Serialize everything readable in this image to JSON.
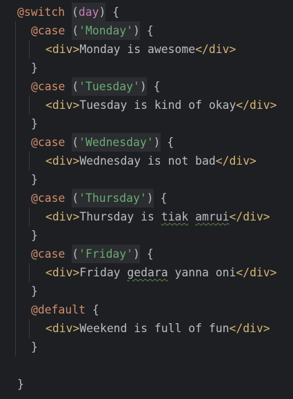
{
  "colors": {
    "background": "#1e1f22",
    "keyword": "#cf8e6d",
    "string": "#6aab73",
    "variable": "#c77dbb",
    "tag": "#d5b778",
    "text": "#bcbec4"
  },
  "lines": [
    {
      "indent": 1,
      "tokens": [
        {
          "t": "kw",
          "v": "@switch"
        },
        {
          "t": "pun",
          "v": " "
        },
        {
          "t": "pun",
          "v": "(",
          "hl": true
        },
        {
          "t": "var",
          "v": "day",
          "hl": true
        },
        {
          "t": "pun",
          "v": ")",
          "hl": true
        },
        {
          "t": "pun",
          "v": " {"
        }
      ]
    },
    {
      "indent": 2,
      "tokens": [
        {
          "t": "kw",
          "v": "@case"
        },
        {
          "t": "pun",
          "v": " "
        },
        {
          "t": "pun",
          "v": "(",
          "hl": true
        },
        {
          "t": "str",
          "v": "'Monday'",
          "hl": true
        },
        {
          "t": "pun",
          "v": ")",
          "hl": true
        },
        {
          "t": "pun",
          "v": " {"
        }
      ]
    },
    {
      "indent": 3,
      "tokens": [
        {
          "t": "tag",
          "v": "<div>"
        },
        {
          "t": "txt",
          "v": "Monday is awesome"
        },
        {
          "t": "tag",
          "v": "</div>"
        }
      ]
    },
    {
      "indent": 2,
      "tokens": [
        {
          "t": "pun",
          "v": "}"
        }
      ]
    },
    {
      "indent": 2,
      "tokens": [
        {
          "t": "kw",
          "v": "@case"
        },
        {
          "t": "pun",
          "v": " "
        },
        {
          "t": "pun",
          "v": "(",
          "hl": true
        },
        {
          "t": "str",
          "v": "'Tuesday'",
          "hl": true
        },
        {
          "t": "pun",
          "v": ")",
          "hl": true
        },
        {
          "t": "pun",
          "v": " {"
        }
      ]
    },
    {
      "indent": 3,
      "tokens": [
        {
          "t": "tag",
          "v": "<div>"
        },
        {
          "t": "txt",
          "v": "Tuesday is kind of okay"
        },
        {
          "t": "tag",
          "v": "</div>"
        }
      ]
    },
    {
      "indent": 2,
      "tokens": [
        {
          "t": "pun",
          "v": "}"
        }
      ]
    },
    {
      "indent": 2,
      "tokens": [
        {
          "t": "kw",
          "v": "@case"
        },
        {
          "t": "pun",
          "v": " "
        },
        {
          "t": "pun",
          "v": "(",
          "hl": true
        },
        {
          "t": "str",
          "v": "'Wednesday'",
          "hl": true
        },
        {
          "t": "pun",
          "v": ")",
          "hl": true
        },
        {
          "t": "pun",
          "v": " {"
        }
      ]
    },
    {
      "indent": 3,
      "tokens": [
        {
          "t": "tag",
          "v": "<div>"
        },
        {
          "t": "txt",
          "v": "Wednesday is not bad"
        },
        {
          "t": "tag",
          "v": "</div>"
        }
      ]
    },
    {
      "indent": 2,
      "tokens": [
        {
          "t": "pun",
          "v": "}"
        }
      ]
    },
    {
      "indent": 2,
      "tokens": [
        {
          "t": "kw",
          "v": "@case"
        },
        {
          "t": "pun",
          "v": " "
        },
        {
          "t": "pun",
          "v": "(",
          "hl": true
        },
        {
          "t": "str",
          "v": "'Thursday'",
          "hl": true
        },
        {
          "t": "pun",
          "v": ")",
          "hl": true
        },
        {
          "t": "pun",
          "v": " {"
        }
      ]
    },
    {
      "indent": 3,
      "tokens": [
        {
          "t": "tag",
          "v": "<div>"
        },
        {
          "t": "txt",
          "v": "Thursday is "
        },
        {
          "t": "txt",
          "v": "tiak",
          "typo": true
        },
        {
          "t": "txt",
          "v": " "
        },
        {
          "t": "txt",
          "v": "amrui",
          "typo": true
        },
        {
          "t": "tag",
          "v": "</div>"
        }
      ]
    },
    {
      "indent": 2,
      "tokens": [
        {
          "t": "pun",
          "v": "}"
        }
      ]
    },
    {
      "indent": 2,
      "tokens": [
        {
          "t": "kw",
          "v": "@case"
        },
        {
          "t": "pun",
          "v": " "
        },
        {
          "t": "pun",
          "v": "(",
          "hl": true
        },
        {
          "t": "str",
          "v": "'Friday'",
          "hl": true
        },
        {
          "t": "pun",
          "v": ")",
          "hl": true
        },
        {
          "t": "pun",
          "v": " {"
        }
      ]
    },
    {
      "indent": 3,
      "tokens": [
        {
          "t": "tag",
          "v": "<div>"
        },
        {
          "t": "txt",
          "v": "Friday "
        },
        {
          "t": "txt",
          "v": "gedara",
          "typo": true
        },
        {
          "t": "txt",
          "v": " yanna oni"
        },
        {
          "t": "tag",
          "v": "</div>"
        }
      ]
    },
    {
      "indent": 2,
      "tokens": [
        {
          "t": "pun",
          "v": "}"
        }
      ]
    },
    {
      "indent": 2,
      "tokens": [
        {
          "t": "kw",
          "v": "@default"
        },
        {
          "t": "pun",
          "v": " {"
        }
      ]
    },
    {
      "indent": 3,
      "tokens": [
        {
          "t": "tag",
          "v": "<div>"
        },
        {
          "t": "txt",
          "v": "Weekend is full of fun"
        },
        {
          "t": "tag",
          "v": "</div>"
        }
      ]
    },
    {
      "indent": 2,
      "tokens": [
        {
          "t": "pun",
          "v": "}"
        }
      ]
    },
    {
      "indent": 0,
      "tokens": []
    },
    {
      "indent": 1,
      "tokens": [
        {
          "t": "pun",
          "v": "}"
        }
      ]
    }
  ]
}
